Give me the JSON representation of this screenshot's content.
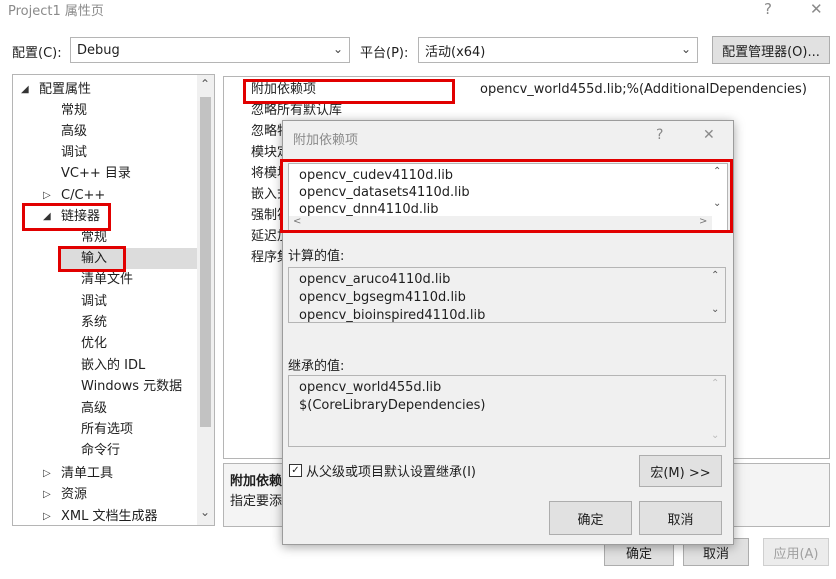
{
  "window": {
    "title": "Project1 属性页",
    "help": "?",
    "close": "✕"
  },
  "toolbar": {
    "config_label": "配置(C):",
    "config_value": "Debug",
    "platform_label": "平台(P):",
    "platform_value": "活动(x64)",
    "config_manager": "配置管理器(O)..."
  },
  "tree": {
    "items": [
      {
        "label": "配置属性",
        "arrow": "◢"
      },
      {
        "label": "常规"
      },
      {
        "label": "高级"
      },
      {
        "label": "调试"
      },
      {
        "label": "VC++ 目录"
      },
      {
        "label": "C/C++",
        "arrow": "▷"
      },
      {
        "label": "链接器",
        "arrow": "◢"
      },
      {
        "label": "常规"
      },
      {
        "label": "输入"
      },
      {
        "label": "清单文件"
      },
      {
        "label": "调试"
      },
      {
        "label": "系统"
      },
      {
        "label": "优化"
      },
      {
        "label": "嵌入的 IDL"
      },
      {
        "label": "Windows 元数据"
      },
      {
        "label": "高级"
      },
      {
        "label": "所有选项"
      },
      {
        "label": "命令行"
      },
      {
        "label": "清单工具",
        "arrow": "▷"
      },
      {
        "label": "资源",
        "arrow": "▷"
      },
      {
        "label": "XML 文档生成器",
        "arrow": "▷"
      }
    ],
    "scroll_up": "⌃",
    "scroll_down": "⌄"
  },
  "grid": {
    "rows": [
      {
        "name": "附加依赖项",
        "value": "opencv_world455d.lib;%(AdditionalDependencies)"
      },
      {
        "name": "忽略所有默认库",
        "value": ""
      },
      {
        "name": "忽略特",
        "value": ""
      },
      {
        "name": "模块定",
        "value": ""
      },
      {
        "name": "将模块",
        "value": ""
      },
      {
        "name": "嵌入式",
        "value": ""
      },
      {
        "name": "强制符",
        "value": ""
      },
      {
        "name": "延迟加",
        "value": ""
      },
      {
        "name": "程序集",
        "value": ""
      }
    ]
  },
  "description": {
    "title": "附加依赖",
    "text": "指定要添"
  },
  "main_buttons": {
    "ok": "确定",
    "cancel": "取消",
    "apply": "应用(A)"
  },
  "dialog": {
    "title": "附加依赖项",
    "help": "?",
    "close": "✕",
    "edit_lines": [
      "opencv_cudev4110d.lib",
      "opencv_datasets4110d.lib",
      "opencv_dnn4110d.lib"
    ],
    "computed_label": "计算的值:",
    "computed_lines": [
      "opencv_aruco4110d.lib",
      "opencv_bgsegm4110d.lib",
      "opencv_bioinspired4110d.lib"
    ],
    "inherited_label": "继承的值:",
    "inherited_lines": [
      "opencv_world455d.lib",
      "$(CoreLibraryDependencies)"
    ],
    "inherit_checkbox": "从父级或项目默认设置继承(I)",
    "inherit_checked": true,
    "check_mark": "✓",
    "macro_button": "宏(M) >>",
    "ok": "确定",
    "cancel": "取消",
    "up": "⌃",
    "down": "⌄",
    "left": "<",
    "right": ">"
  },
  "colors": {
    "highlight_red": "#e10000",
    "selected_bg": "#dcdcdc"
  }
}
